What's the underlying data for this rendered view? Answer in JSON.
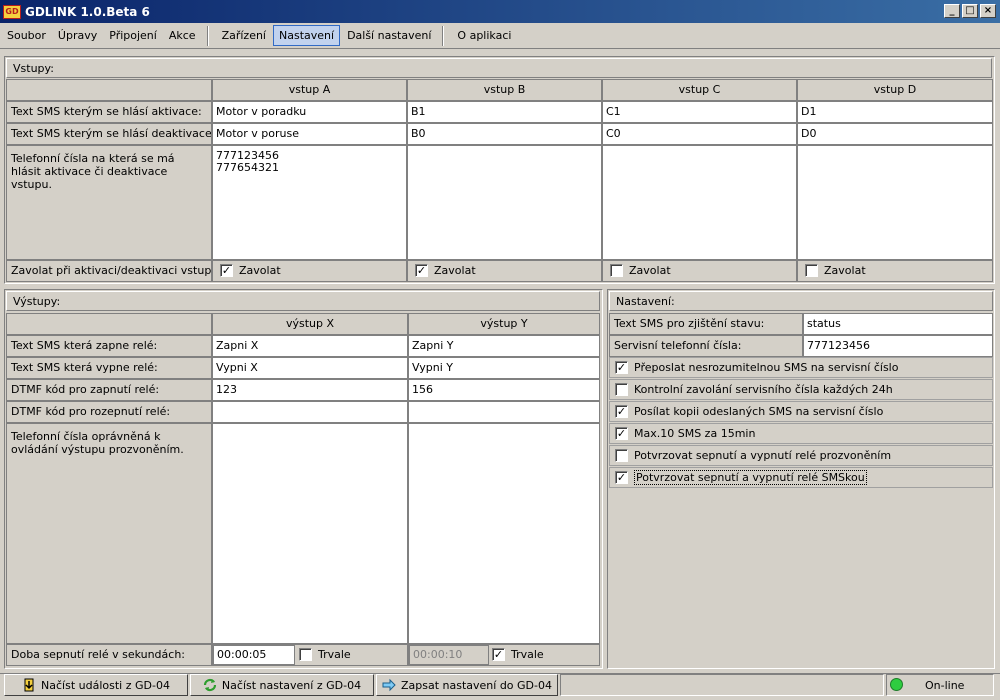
{
  "window": {
    "title": "GDLINK 1.0.Beta 6",
    "icon_text": "GD",
    "buttons": [
      "_",
      "□",
      "×"
    ]
  },
  "menu": {
    "left": [
      "Soubor",
      "Úpravy",
      "Připojení",
      "Akce"
    ],
    "right": [
      "Zařízení",
      "Nastavení",
      "Další nastavení"
    ],
    "about": "O aplikaci",
    "active": "Nastavení"
  },
  "inputs_panel": {
    "title": "Vstupy:",
    "columns": [
      "vstup A",
      "vstup B",
      "vstup C",
      "vstup D"
    ],
    "row_labels": {
      "activation": "Text SMS kterým se hlásí aktivace:",
      "deactivation": "Text SMS kterým se hlásí deaktivace:",
      "phones": "Telefonní čísla na která se má hlásit aktivace či deaktivace vstupu.",
      "call": "Zavolat při aktivaci/deaktivaci vstupu:"
    },
    "activation": [
      "Motor v poradku",
      "B1",
      "C1",
      "D1"
    ],
    "deactivation": [
      "Motor v poruse",
      "B0",
      "C0",
      "D0"
    ],
    "phones": [
      "777123456\n777654321",
      "",
      "",
      ""
    ],
    "call_label": "Zavolat",
    "call_checked": [
      true,
      true,
      false,
      false
    ]
  },
  "outputs_panel": {
    "title": "Výstupy:",
    "columns": [
      "výstup X",
      "výstup Y"
    ],
    "row_labels": {
      "on_sms": "Text SMS která zapne relé:",
      "off_sms": "Text SMS která vypne relé:",
      "dtmf_on": "DTMF kód pro zapnutí relé:",
      "dtmf_off": "DTMF kód pro rozepnutí relé:",
      "phones": "Telefonní čísla oprávněná k ovládání výstupu prozvoněním.",
      "duration": "Doba sepnutí relé v sekundách:"
    },
    "on_sms": [
      "Zapni X",
      "Zapni Y"
    ],
    "off_sms": [
      "Vypni X",
      "Vypni Y"
    ],
    "dtmf_on": [
      "123",
      "156"
    ],
    "dtmf_off": [
      "",
      ""
    ],
    "phones": [
      "",
      ""
    ],
    "duration": [
      "00:00:05",
      "00:00:10"
    ],
    "permanent_label": "Trvale",
    "permanent_checked": [
      false,
      true
    ]
  },
  "settings_panel": {
    "title": "Nastavení:",
    "status_sms_label": "Text SMS pro zjištění stavu:",
    "status_sms_value": "status",
    "service_phone_label": "Servisní telefonní čísla:",
    "service_phone_value": "777123456",
    "options": [
      {
        "label": "Přeposlat nesrozumitelnou SMS na servisní číslo",
        "checked": true
      },
      {
        "label": "Kontrolní zavolání servisního čísla každých 24h",
        "checked": false
      },
      {
        "label": "Posílat kopii odeslaných SMS na servisní číslo",
        "checked": true
      },
      {
        "label": "Max.10 SMS za 15min",
        "checked": true
      },
      {
        "label": "Potvrzovat sepnutí a vypnutí relé prozvoněním",
        "checked": false
      },
      {
        "label": "Potvrzovat sepnutí a vypnutí relé SMSkou",
        "checked": true
      }
    ]
  },
  "statusbar": {
    "load_events": "Načíst události z GD-04",
    "load_settings": "Načíst nastavení z GD-04",
    "write_settings": "Zapsat nastavení do GD-04",
    "connection_status": "On-line"
  },
  "colors": {
    "led": "#2ecc40",
    "title_start": "#0a246a",
    "title_end": "#3a6ea5"
  }
}
